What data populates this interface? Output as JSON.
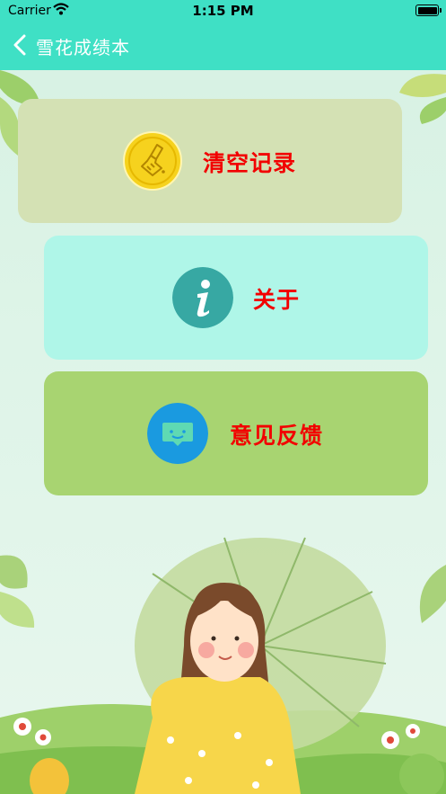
{
  "status_bar": {
    "carrier": "Carrier",
    "time": "1:15 PM"
  },
  "nav": {
    "title": "雪花成绩本",
    "back_icon": "chevron-left-icon"
  },
  "menu": [
    {
      "id": "clear",
      "label": "清空记录",
      "icon": "broom-icon"
    },
    {
      "id": "about",
      "label": "关于",
      "icon": "info-icon"
    },
    {
      "id": "feedback",
      "label": "意见反馈",
      "icon": "chat-smile-icon"
    }
  ],
  "colors": {
    "nav_bar": "#3fe0c5",
    "label": "#f20000",
    "card_clear": "#d4e1b4",
    "card_about": "#aff6e8",
    "card_feedback": "#a8d471"
  }
}
